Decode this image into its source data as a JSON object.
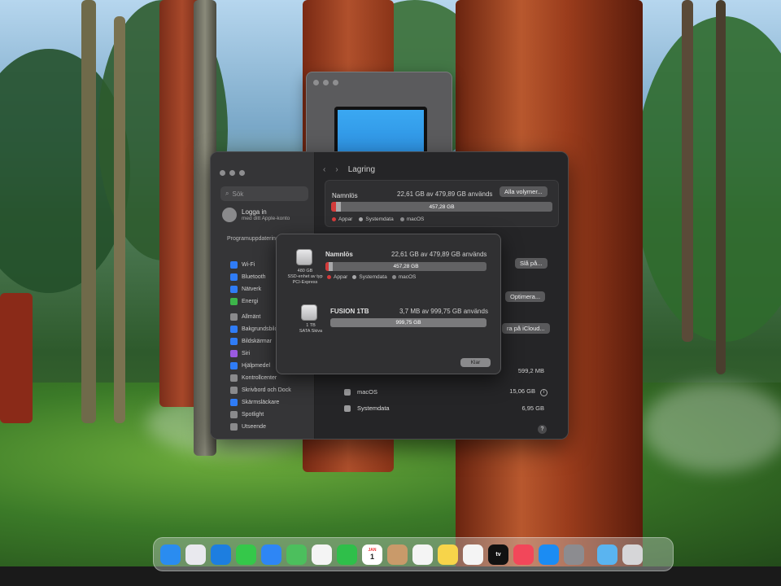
{
  "settings": {
    "nav_title": "Lagring",
    "sidebar": {
      "search_placeholder": "Sök",
      "account_line1": "Logga in",
      "account_line2": "med ditt Apple-konto",
      "update_note": "Programuppdatering tillgänglig",
      "items": [
        {
          "label": "Wi-Fi",
          "icon": "wifi-icon"
        },
        {
          "label": "Bluetooth",
          "icon": "bluetooth-icon"
        },
        {
          "label": "Nätverk",
          "icon": "network-icon"
        },
        {
          "label": "Energi",
          "icon": "energy-icon"
        },
        {
          "label": "Allmänt",
          "icon": "gear-icon"
        },
        {
          "label": "Bakgrundsbild",
          "icon": "wallpaper-icon"
        },
        {
          "label": "Bildskärmar",
          "icon": "display-icon"
        },
        {
          "label": "Siri",
          "icon": "siri-icon"
        },
        {
          "label": "Hjälpmedel",
          "icon": "accessibility-icon"
        },
        {
          "label": "Kontrollcenter",
          "icon": "control-center-icon"
        },
        {
          "label": "Skrivbord och Dock",
          "icon": "desktop-dock-icon"
        },
        {
          "label": "Skärmsläckare",
          "icon": "screensaver-icon"
        },
        {
          "label": "Spotlight",
          "icon": "spotlight-icon"
        },
        {
          "label": "Utseende",
          "icon": "appearance-icon"
        }
      ]
    },
    "main": {
      "drive_name": "Namnlös",
      "drive_usage": "22,61 GB av 479,89 GB används",
      "all_volumes_button": "Alla volymer...",
      "bar_label": "457,28 GB",
      "legend": [
        "Appar",
        "Systemdata",
        "macOS"
      ],
      "turn_on_button": "Slå på...",
      "optimize_button": "Optimera...",
      "icloud_button": "ra på iCloud...",
      "rows": [
        {
          "label": "",
          "size": "599,2 MB"
        },
        {
          "label": "macOS",
          "size": "15,06 GB"
        },
        {
          "label": "Systemdata",
          "size": "6,95 GB"
        }
      ],
      "help_label": "?"
    }
  },
  "sheet": {
    "disk1": {
      "size": "480 GB",
      "desc": "SSD-enhet av typ PCI-Express",
      "name": "Namnlös",
      "usage": "22,61 GB av 479,89 GB används",
      "bar_label": "457,28 GB",
      "used_fraction": 0.047,
      "legend": [
        "Appar",
        "Systemdata",
        "macOS"
      ]
    },
    "disk2": {
      "size": "1 TB",
      "desc": "SATA Skiva",
      "name": "FUSION 1TB",
      "usage": "3,7 MB av 999,75 GB används",
      "bar_label": "999,75 GB"
    },
    "done_button": "Klar"
  },
  "dock": {
    "apps": [
      {
        "name": "Finder",
        "color": "#2a8cf0"
      },
      {
        "name": "Launchpad",
        "color": "#e9e9ee"
      },
      {
        "name": "Safari",
        "color": "#1d7ee0"
      },
      {
        "name": "Messages",
        "color": "#35c84a"
      },
      {
        "name": "Mail",
        "color": "#2e86f5"
      },
      {
        "name": "Maps",
        "color": "#4cbf5d"
      },
      {
        "name": "Photos",
        "color": "#f4f4f4"
      },
      {
        "name": "FaceTime",
        "color": "#2fbf4a"
      },
      {
        "name": "Calendar",
        "color": "#ffffff"
      },
      {
        "name": "Contacts",
        "color": "#c99a6a"
      },
      {
        "name": "Reminders",
        "color": "#f4f4f4"
      },
      {
        "name": "Notes",
        "color": "#f7d44a"
      },
      {
        "name": "Freeform",
        "color": "#f4f4f4"
      },
      {
        "name": "TV",
        "color": "#111111"
      },
      {
        "name": "Music",
        "color": "#f2475a"
      },
      {
        "name": "App Store",
        "color": "#1b8cf3"
      },
      {
        "name": "System Settings",
        "color": "#8c8c90"
      },
      {
        "name": "Folder",
        "color": "#5ab4f0"
      },
      {
        "name": "Trash",
        "color": "#d6d6d8"
      }
    ],
    "calendar_month": "JAN",
    "calendar_day": "1",
    "tv_label": "tv"
  }
}
